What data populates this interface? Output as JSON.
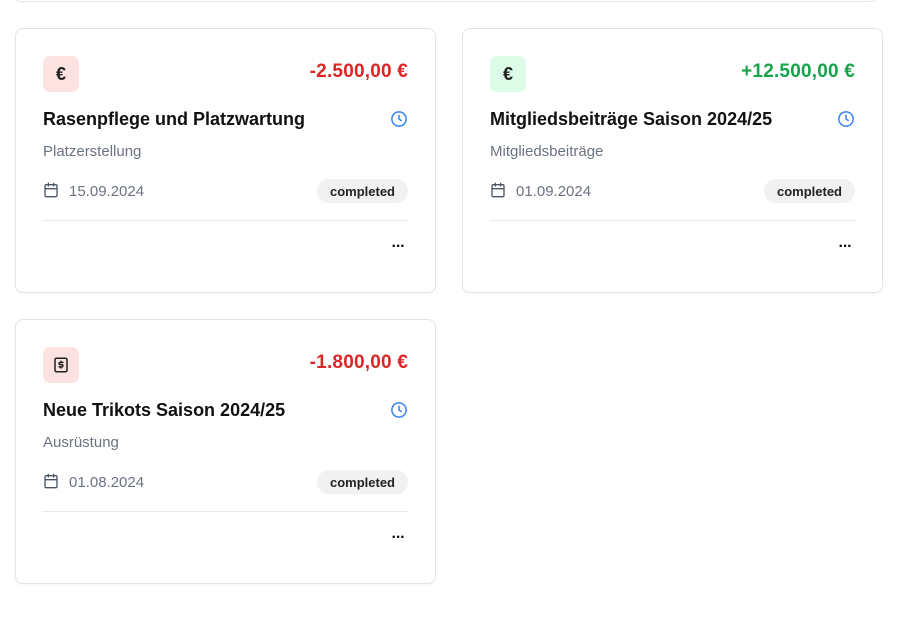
{
  "cards": [
    {
      "icon": "euro-icon",
      "icon_glyph": "€",
      "type": "expense",
      "amount": "-2.500,00 €",
      "title": "Rasenpflege und Platzwartung",
      "category": "Platzerstellung",
      "date": "15.09.2024",
      "status": "completed",
      "more": "···"
    },
    {
      "icon": "euro-icon",
      "icon_glyph": "€",
      "type": "income",
      "amount": "+12.500,00 €",
      "title": "Mitgliedsbeiträge Saison 2024/25",
      "category": "Mitgliedsbeiträge",
      "date": "01.09.2024",
      "status": "completed",
      "more": "···"
    },
    {
      "icon": "receipt-dollar-icon",
      "icon_glyph": "$",
      "type": "expense",
      "amount": "-1.800,00 €",
      "title": "Neue Trikots Saison 2024/25",
      "category": "Ausrüstung",
      "date": "01.08.2024",
      "status": "completed",
      "more": "···"
    }
  ],
  "colors": {
    "expense": "#dc2626",
    "income": "#16a34a",
    "clock": "#3b82f6"
  }
}
